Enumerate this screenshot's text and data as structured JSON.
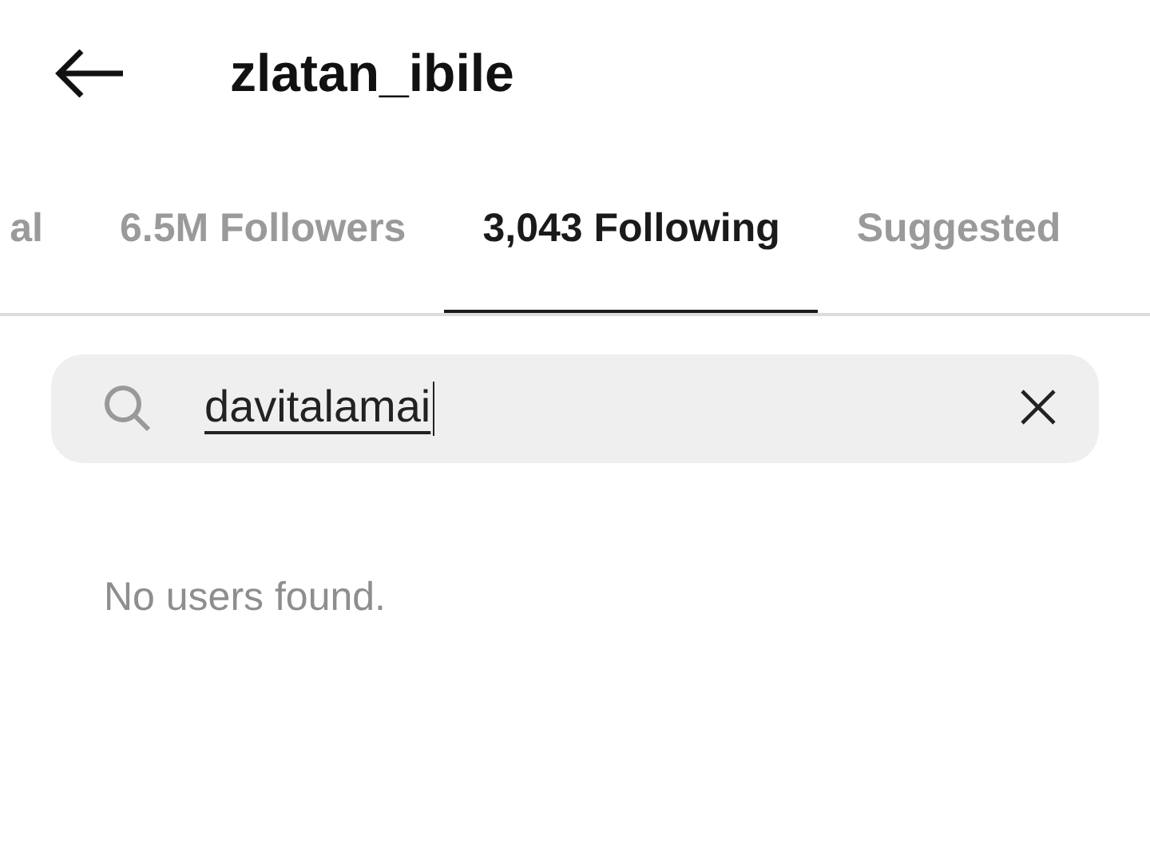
{
  "header": {
    "title": "zlatan_ibile"
  },
  "tabs": [
    {
      "label": "al",
      "selected": false
    },
    {
      "label": "6.5M Followers",
      "selected": false
    },
    {
      "label": "3,043 Following",
      "selected": true
    },
    {
      "label": "Suggested",
      "selected": false
    }
  ],
  "search": {
    "value": "davitalamai",
    "composing": true
  },
  "message": "No users found."
}
